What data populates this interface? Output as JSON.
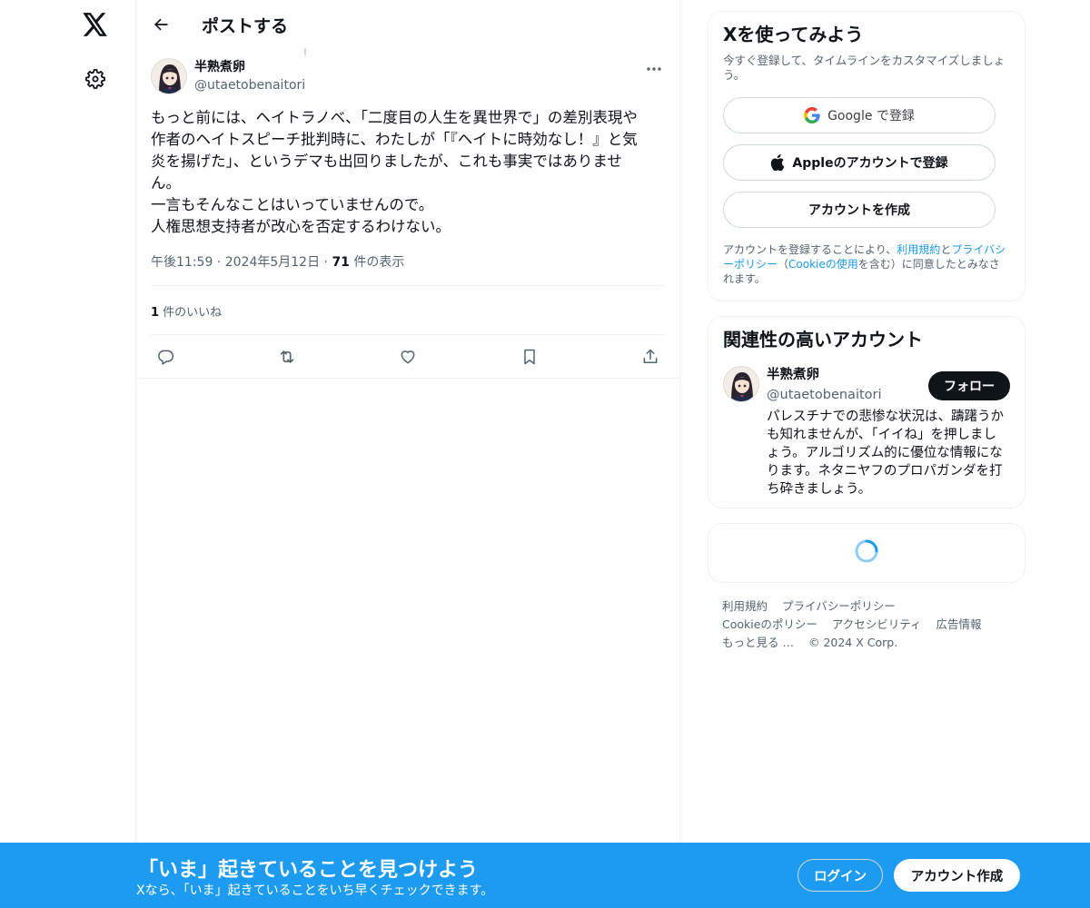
{
  "rail": {
    "logo_icon": "x-logo-icon",
    "settings_icon": "gear-icon"
  },
  "header": {
    "title": "ポストする"
  },
  "post": {
    "author_name": "半熟煮卵",
    "author_handle": "@utaetobenaitori",
    "body": "もっと前には、ヘイトラノベ、「二度目の人生を異世界で」の差別表現や\n作者のヘイトスピーチ批判時に、わたしが「『ヘイトに時効なし！』と気\n炎を揚げた」、というデマも出回りましたが、これも事実ではありませ\nん。\n一言もそんなことはいっていませんので。\n人権思想支持者が改心を否定するわけない。",
    "time": "午後11:59",
    "date": "2024年5月12日",
    "views_count": "71",
    "views_label": " 件の表示",
    "likes_count": "1",
    "likes_label": " 件のいいね"
  },
  "signup_card": {
    "title": "Xを使ってみよう",
    "subtitle": "今すぐ登録して、タイムラインをカスタマイズしましょう。",
    "google_label": "Google で登録",
    "apple_label": "Appleのアカウントで登録",
    "create_label": "アカウントを作成",
    "legal_prefix": "アカウントを登録することにより、",
    "terms_link": "利用規約",
    "and": "と",
    "privacy_link": "プライバシーポリシー",
    "paren_open": "（",
    "cookie_link": "Cookieの使用",
    "legal_suffix": "を含む）に同意したとみなされます。"
  },
  "related": {
    "title": "関連性の高いアカウント",
    "name": "半熟煮卵",
    "handle": "@utaetobenaitori",
    "bio": "パレスチナでの悲惨な状況は、躊躇うかも知れませんが、「イイね」を押しましょう。アルゴリズム的に優位な情報になります。ネタニヤフのプロパガンダを打ち砕きましょう。",
    "follow_label": "フォロー"
  },
  "footer": {
    "terms": "利用規約",
    "privacy": "プライバシーポリシー",
    "cookie": "Cookieのポリシー",
    "accessibility": "アクセシビリティ",
    "ads": "広告情報",
    "more": "もっと見る …",
    "copyright": "© 2024 X Corp."
  },
  "banner": {
    "title": "「いま」起きていることを見つけよう",
    "subtitle": "Xなら、「いま」起きていることをいち早くチェックできます。",
    "login_label": "ログイン",
    "signup_label": "アカウント作成"
  },
  "colors": {
    "accent": "#1d9bf0",
    "text": "#0f1419",
    "muted": "#536471",
    "border": "#eff3f4"
  }
}
